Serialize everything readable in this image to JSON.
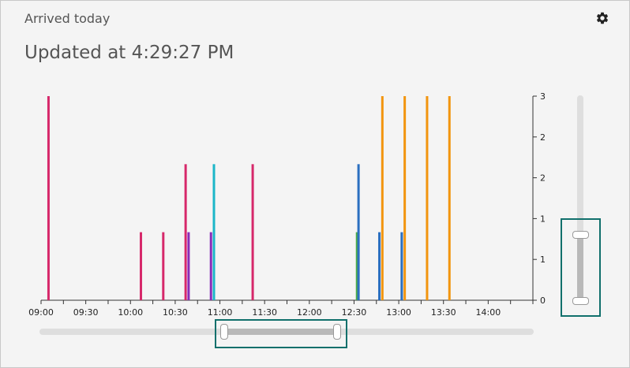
{
  "header": {
    "title": "Arrived today",
    "updated": "Updated at 4:29:27 PM"
  },
  "chart_data": {
    "type": "bar",
    "x_ticks": [
      "09:00",
      "09:30",
      "10:00",
      "10:30",
      "11:00",
      "11:30",
      "12:00",
      "12:30",
      "13:00",
      "13:30",
      "14:00"
    ],
    "y_ticks": [
      "0",
      "1",
      "1",
      "2",
      "2",
      "3"
    ],
    "ylim": [
      0,
      3
    ],
    "bars": [
      {
        "time": "09:05",
        "value": 3,
        "color": "#d6286a"
      },
      {
        "time": "10:07",
        "value": 1,
        "color": "#d6286a"
      },
      {
        "time": "10:22",
        "value": 1,
        "color": "#d6286a"
      },
      {
        "time": "10:37",
        "value": 2,
        "color": "#d6286a"
      },
      {
        "time": "10:39",
        "value": 1,
        "color": "#8a2bb8"
      },
      {
        "time": "10:54",
        "value": 1,
        "color": "#8a2bb8"
      },
      {
        "time": "10:56",
        "value": 2,
        "color": "#1bb6c8"
      },
      {
        "time": "11:22",
        "value": 2,
        "color": "#d6286a"
      },
      {
        "time": "12:32",
        "value": 1,
        "color": "#4aac4a"
      },
      {
        "time": "12:33",
        "value": 2,
        "color": "#2a6fc0"
      },
      {
        "time": "12:47",
        "value": 1,
        "color": "#2a6fc0"
      },
      {
        "time": "12:49",
        "value": 3,
        "color": "#f2950f"
      },
      {
        "time": "13:02",
        "value": 1,
        "color": "#2a6fc0"
      },
      {
        "time": "13:04",
        "value": 3,
        "color": "#f2950f"
      },
      {
        "time": "13:19",
        "value": 3,
        "color": "#f2950f"
      },
      {
        "time": "13:34",
        "value": 3,
        "color": "#f2950f"
      }
    ]
  }
}
